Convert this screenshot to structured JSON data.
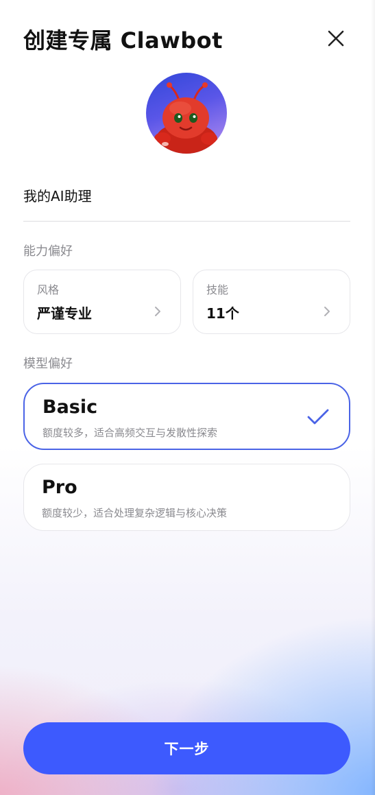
{
  "header": {
    "title": "创建专属 Clawbot"
  },
  "assistant": {
    "name": "我的AI助理"
  },
  "ability": {
    "section_label": "能力偏好",
    "style": {
      "label": "风格",
      "value": "严谨专业"
    },
    "skills": {
      "label": "技能",
      "value": "11个"
    }
  },
  "model": {
    "section_label": "模型偏好",
    "options": [
      {
        "name": "Basic",
        "description": "额度较多，适合高频交互与发散性探索",
        "selected": true
      },
      {
        "name": "Pro",
        "description": "额度较少，适合处理复杂逻辑与核心决策",
        "selected": false
      }
    ]
  },
  "footer": {
    "next_label": "下一步"
  },
  "colors": {
    "accent": "#3d5afe",
    "selected_border": "#4a63e6",
    "check": "#4a63e6",
    "muted_text": "#8a8a8f"
  }
}
